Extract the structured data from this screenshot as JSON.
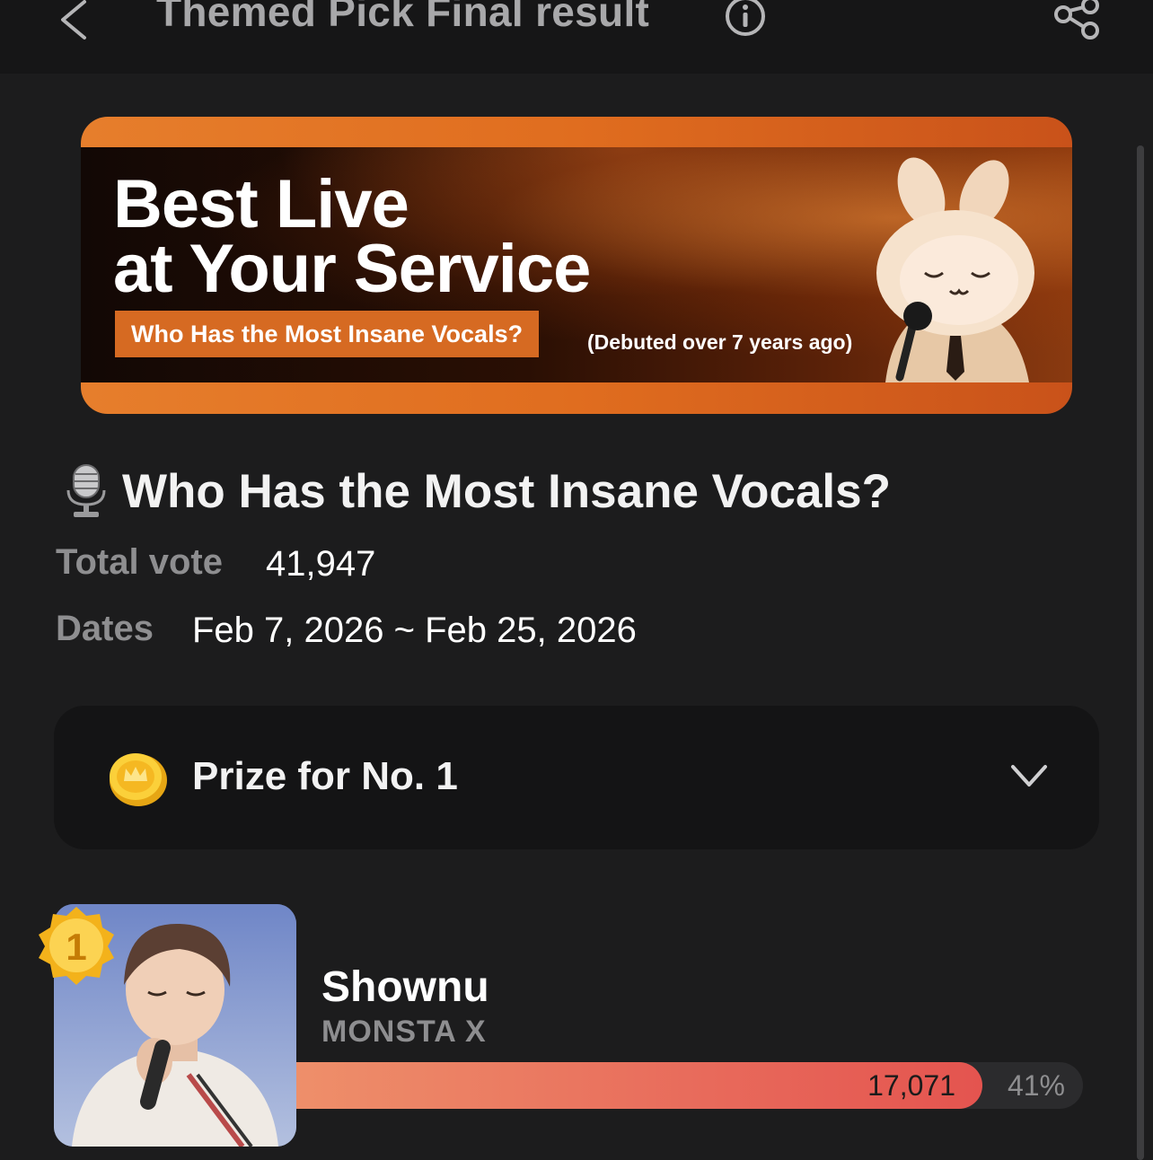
{
  "header": {
    "title": "Themed Pick Final result",
    "back_icon": "chevron-left-icon",
    "info_icon": "info-icon",
    "share_icon": "share-icon"
  },
  "banner": {
    "title_line1": "Best Live",
    "title_line2": "at Your Service",
    "subtitle": "Who Has the Most Insane Vocals?",
    "note": "(Debuted over 7 years ago)"
  },
  "poll": {
    "title": "Who Has the Most Insane Vocals?",
    "total_vote_label": "Total vote",
    "total_vote_value": "41,947",
    "dates_label": "Dates",
    "dates_value": "Feb 7, 2026 ~ Feb 25, 2026"
  },
  "prize": {
    "label": "Prize for No. 1"
  },
  "ranking": [
    {
      "rank": "1",
      "name": "Shownu",
      "group": "MONSTA X",
      "votes": "17,071",
      "percent_label": "41%",
      "share": 0.41
    }
  ],
  "colors": {
    "background": "#1c1c1d",
    "accent_orange": "#e06d1f",
    "bar_start": "#ee8f6a",
    "bar_end": "#e4544f"
  }
}
